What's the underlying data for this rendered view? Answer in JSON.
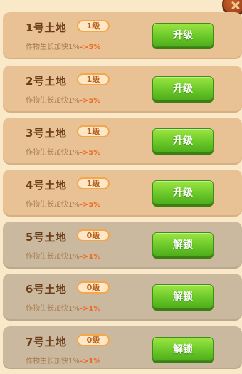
{
  "plots": [
    {
      "name": "1号土地",
      "level": "1级",
      "growth_label": "作物生长加快1%",
      "growth_change": "->5%",
      "button": "升级",
      "state": "unlocked"
    },
    {
      "name": "2号土地",
      "level": "1级",
      "growth_label": "作物生长加快1%",
      "growth_change": "->5%",
      "button": "升级",
      "state": "unlocked"
    },
    {
      "name": "3号土地",
      "level": "1级",
      "growth_label": "作物生长加快1%",
      "growth_change": "->5%",
      "button": "升级",
      "state": "unlocked"
    },
    {
      "name": "4号土地",
      "level": "1级",
      "growth_label": "作物生长加快1%",
      "growth_change": "->5%",
      "button": "升级",
      "state": "unlocked"
    },
    {
      "name": "5号土地",
      "level": "0级",
      "growth_label": "作物生长加快1%",
      "growth_change": "->1%",
      "button": "解锁",
      "state": "locked"
    },
    {
      "name": "6号土地",
      "level": "0级",
      "growth_label": "作物生长加快1%",
      "growth_change": "->1%",
      "button": "解锁",
      "state": "locked"
    },
    {
      "name": "7号土地",
      "level": "0级",
      "growth_label": "作物生长加快1%",
      "growth_change": "->1%",
      "button": "解锁",
      "state": "locked"
    }
  ],
  "colors": {
    "unlocked_row": "#e8c294",
    "locked_row": "#cbb99f",
    "button_green": "#6cc92a",
    "growth_highlight": "#ec6a2a"
  },
  "icons": {
    "close": "close-icon"
  }
}
